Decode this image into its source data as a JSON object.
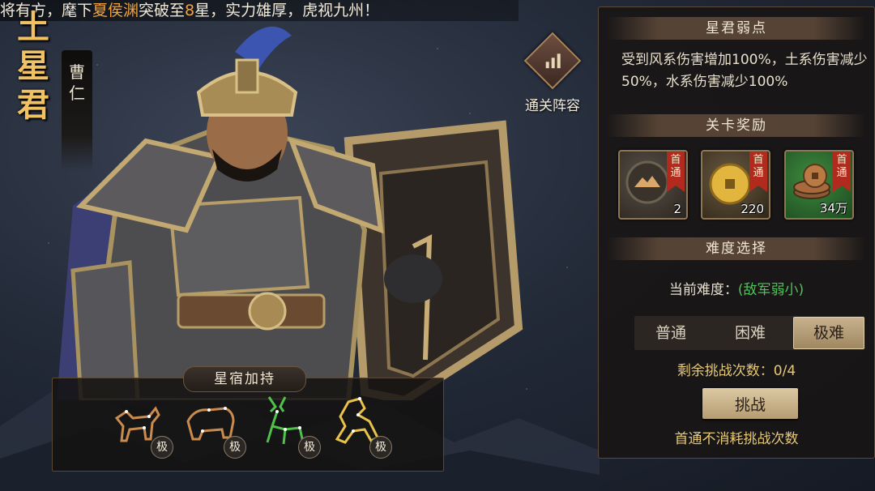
{
  "marquee": {
    "part1": "将有方，麾下",
    "hero": "夏侯渊",
    "part2": "突破至",
    "star": "8",
    "part3": "星，实力雄厚，虎视九州！"
  },
  "stage": {
    "name": "土星君",
    "hero_line1": "曹",
    "hero_line2": "仁"
  },
  "lineup_label": "通关阵容",
  "weakness": {
    "title": "星君弱点",
    "text": "受到风系伤害增加100%，土系伤害减少50%，水系伤害减少100%"
  },
  "rewards": {
    "title": "关卡奖励",
    "ribbon": "首通",
    "items": [
      {
        "icon": "mountain-token-icon",
        "count": "2"
      },
      {
        "icon": "gold-coin-icon",
        "count": "220"
      },
      {
        "icon": "copper-coins-icon",
        "count": "34万"
      }
    ]
  },
  "difficulty": {
    "title": "难度选择",
    "current_label": "当前难度：",
    "current_value": "(敌军弱小)",
    "options": [
      "普通",
      "困难",
      "极难"
    ],
    "selected": "极难",
    "remaining": "剩余挑战次数：0/4",
    "challenge_button": "挑战",
    "note": "首通不消耗挑战次数"
  },
  "constellation": {
    "title": "星宿加持",
    "items": [
      {
        "icon": "deer-constellation-icon",
        "level": "极",
        "color": "#c98b4e"
      },
      {
        "icon": "bear-constellation-icon",
        "level": "极",
        "color": "#c98b4e"
      },
      {
        "icon": "stag-constellation-icon",
        "level": "极",
        "color": "#4fc24a"
      },
      {
        "icon": "horse-constellation-icon",
        "level": "极",
        "color": "#e8c34a"
      }
    ]
  },
  "colors": {
    "accent_gold": "#f1c264",
    "highlight_orange": "#f0a441",
    "green": "#4fc25a",
    "ribbon_red": "#b22a1e"
  }
}
